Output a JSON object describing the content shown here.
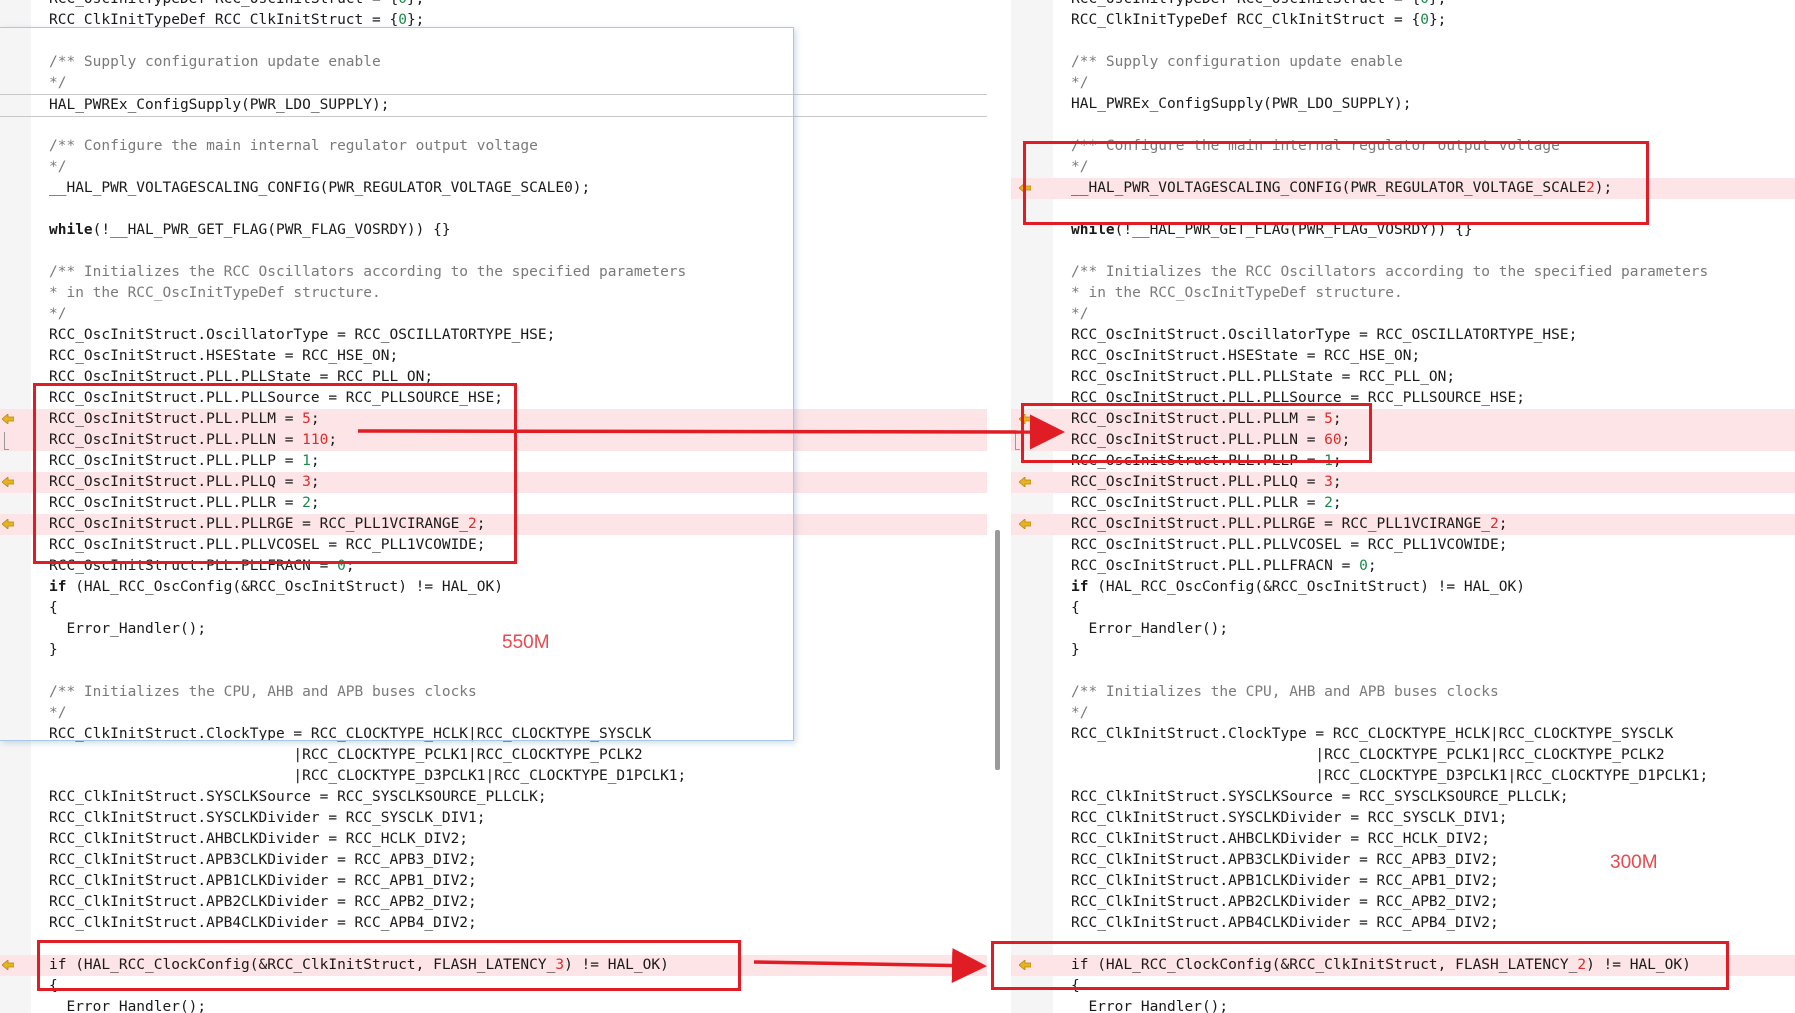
{
  "colors": {
    "diff_bg": "#fde4e6",
    "changed_text": "#e02b2b",
    "number_text": "#1a8a4a",
    "comment_text": "#7a7a7a",
    "annotation_red": "#e01c24"
  },
  "annotations": {
    "left_label": "550M",
    "right_label": "300M"
  },
  "left": {
    "lines": [
      {
        "parts": [
          {
            "t": "RCC_OscInitTypeDef RCC_OscInitStruct = {"
          },
          {
            "t": "0",
            "c": "num"
          },
          {
            "t": "};"
          }
        ]
      },
      {
        "parts": [
          {
            "t": "RCC_ClkInitTypeDef RCC_ClkInitStruct = {"
          },
          {
            "t": "0",
            "c": "num"
          },
          {
            "t": "};"
          }
        ]
      },
      {
        "parts": []
      },
      {
        "parts": [
          {
            "t": "/** Supply configuration update enable",
            "c": "cm"
          }
        ]
      },
      {
        "parts": [
          {
            "t": "*/",
            "c": "cm"
          }
        ]
      },
      {
        "parts": [
          {
            "t": "HAL_PWREx_ConfigSupply(PWR_LDO_SUPPLY);"
          }
        ],
        "boxed": true
      },
      {
        "parts": []
      },
      {
        "parts": [
          {
            "t": "/** Configure the main internal regulator output voltage",
            "c": "cm"
          }
        ]
      },
      {
        "parts": [
          {
            "t": "*/",
            "c": "cm"
          }
        ]
      },
      {
        "parts": [
          {
            "t": "__HAL_PWR_VOLTAGESCALING_CONFIG(PWR_REGULATOR_VOLTAGE_SCALE"
          },
          {
            "t": "0"
          },
          {
            "t": ");"
          }
        ]
      },
      {
        "parts": []
      },
      {
        "parts": [
          {
            "t": "while",
            "c": "kw"
          },
          {
            "t": "(!__HAL_PWR_GET_FLAG(PWR_FLAG_VOSRDY)) {}"
          }
        ]
      },
      {
        "parts": []
      },
      {
        "parts": [
          {
            "t": "/** Initializes the RCC Oscillators according to the specified parameters",
            "c": "cm"
          }
        ]
      },
      {
        "parts": [
          {
            "t": "* in the RCC_OscInitTypeDef structure.",
            "c": "cm"
          }
        ]
      },
      {
        "parts": [
          {
            "t": "*/",
            "c": "cm"
          }
        ]
      },
      {
        "parts": [
          {
            "t": "RCC_OscInitStruct.OscillatorType = RCC_OSCILLATORTYPE_HSE;"
          }
        ]
      },
      {
        "parts": [
          {
            "t": "RCC_OscInitStruct.HSEState = RCC_HSE_ON;"
          }
        ]
      },
      {
        "parts": [
          {
            "t": "RCC_OscInitStruct.PLL.PLLState = RCC_PLL_ON;"
          }
        ]
      },
      {
        "parts": [
          {
            "t": "RCC_OscInitStruct.PLL.PLLSource = RCC_PLLSOURCE_HSE;"
          }
        ]
      },
      {
        "parts": [
          {
            "t": "RCC_OscInitStruct.PLL.PLLM = "
          },
          {
            "t": "5",
            "c": "chg"
          },
          {
            "t": ";"
          }
        ],
        "diff": true,
        "marker": "arrow"
      },
      {
        "parts": [
          {
            "t": "RCC_OscInitStruct.PLL.PLLN = "
          },
          {
            "t": "110",
            "c": "chg"
          },
          {
            "t": ";"
          }
        ],
        "diff": true,
        "marker": "bracket"
      },
      {
        "parts": [
          {
            "t": "RCC_OscInitStruct.PLL.PLLP = "
          },
          {
            "t": "1",
            "c": "num"
          },
          {
            "t": ";"
          }
        ]
      },
      {
        "parts": [
          {
            "t": "RCC_OscInitStruct.PLL.PLLQ = "
          },
          {
            "t": "3",
            "c": "chg"
          },
          {
            "t": ";"
          }
        ],
        "diff": true,
        "marker": "arrow"
      },
      {
        "parts": [
          {
            "t": "RCC_OscInitStruct.PLL.PLLR = "
          },
          {
            "t": "2",
            "c": "num"
          },
          {
            "t": ";"
          }
        ]
      },
      {
        "parts": [
          {
            "t": "RCC_OscInitStruct.PLL.PLLRGE = RCC_PLL1VCIRANGE_"
          },
          {
            "t": "2",
            "c": "chg"
          },
          {
            "t": ";"
          }
        ],
        "diff": true,
        "marker": "arrow"
      },
      {
        "parts": [
          {
            "t": "RCC_OscInitStruct.PLL.PLLVCOSEL = RCC_PLL1VCOWIDE;"
          }
        ]
      },
      {
        "parts": [
          {
            "t": "RCC_OscInitStruct.PLL.PLLFRACN = "
          },
          {
            "t": "0",
            "c": "num"
          },
          {
            "t": ";"
          }
        ]
      },
      {
        "parts": [
          {
            "t": "if",
            "c": "kw"
          },
          {
            "t": " (HAL_RCC_OscConfig(&RCC_OscInitStruct) != HAL_OK)"
          }
        ]
      },
      {
        "parts": [
          {
            "t": "{"
          }
        ]
      },
      {
        "parts": [
          {
            "t": "  Error_Handler();"
          }
        ]
      },
      {
        "parts": [
          {
            "t": "}"
          }
        ]
      },
      {
        "parts": []
      },
      {
        "parts": [
          {
            "t": "/** Initializes the CPU, AHB and APB buses clocks",
            "c": "cm"
          }
        ]
      },
      {
        "parts": [
          {
            "t": "*/",
            "c": "cm"
          }
        ]
      },
      {
        "parts": [
          {
            "t": "RCC_ClkInitStruct.ClockType = RCC_CLOCKTYPE_HCLK|RCC_CLOCKTYPE_SYSCLK"
          }
        ]
      },
      {
        "parts": [
          {
            "t": "                            |RCC_CLOCKTYPE_PCLK1|RCC_CLOCKTYPE_PCLK2"
          }
        ]
      },
      {
        "parts": [
          {
            "t": "                            |RCC_CLOCKTYPE_D3PCLK1|RCC_CLOCKTYPE_D1PCLK1;"
          }
        ]
      },
      {
        "parts": [
          {
            "t": "RCC_ClkInitStruct.SYSCLKSource = RCC_SYSCLKSOURCE_PLLCLK;"
          }
        ]
      },
      {
        "parts": [
          {
            "t": "RCC_ClkInitStruct.SYSCLKDivider = RCC_SYSCLK_DIV1;"
          }
        ]
      },
      {
        "parts": [
          {
            "t": "RCC_ClkInitStruct.AHBCLKDivider = RCC_HCLK_DIV2;"
          }
        ]
      },
      {
        "parts": [
          {
            "t": "RCC_ClkInitStruct.APB3CLKDivider = RCC_APB3_DIV2;"
          }
        ]
      },
      {
        "parts": [
          {
            "t": "RCC_ClkInitStruct.APB1CLKDivider = RCC_APB1_DIV2;"
          }
        ]
      },
      {
        "parts": [
          {
            "t": "RCC_ClkInitStruct.APB2CLKDivider = RCC_APB2_DIV2;"
          }
        ]
      },
      {
        "parts": [
          {
            "t": "RCC_ClkInitStruct.APB4CLKDivider = RCC_APB4_DIV2;"
          }
        ]
      },
      {
        "parts": []
      },
      {
        "parts": [
          {
            "t": "if (HAL_RCC_ClockConfig(&RCC_ClkInitStruct, FLASH_LATENCY_"
          },
          {
            "t": "3",
            "c": "chg"
          },
          {
            "t": ") != HAL_OK)"
          }
        ],
        "diff": true,
        "marker": "arrow"
      },
      {
        "parts": [
          {
            "t": "{"
          }
        ]
      },
      {
        "parts": [
          {
            "t": "  Error_Handler();"
          }
        ]
      }
    ]
  },
  "right": {
    "lines": [
      {
        "parts": [
          {
            "t": "RCC_OscInitTypeDef RCC_OscInitStruct = {"
          },
          {
            "t": "0",
            "c": "num"
          },
          {
            "t": "};"
          }
        ]
      },
      {
        "parts": [
          {
            "t": "RCC_ClkInitTypeDef RCC_ClkInitStruct = {"
          },
          {
            "t": "0",
            "c": "num"
          },
          {
            "t": "};"
          }
        ]
      },
      {
        "parts": []
      },
      {
        "parts": [
          {
            "t": "/** Supply configuration update enable",
            "c": "cm"
          }
        ]
      },
      {
        "parts": [
          {
            "t": "*/",
            "c": "cm"
          }
        ]
      },
      {
        "parts": [
          {
            "t": "HAL_PWREx_ConfigSupply(PWR_LDO_SUPPLY);"
          }
        ]
      },
      {
        "parts": []
      },
      {
        "parts": [
          {
            "t": "/** Configure the main internal regulator output voltage",
            "c": "cm"
          }
        ]
      },
      {
        "parts": [
          {
            "t": "*/",
            "c": "cm"
          }
        ]
      },
      {
        "parts": [
          {
            "t": "__HAL_PWR_VOLTAGESCALING_CONFIG(PWR_REGULATOR_VOLTAGE_SCALE"
          },
          {
            "t": "2",
            "c": "chg"
          },
          {
            "t": ");"
          }
        ],
        "diff": true,
        "marker": "arrow"
      },
      {
        "parts": []
      },
      {
        "parts": [
          {
            "t": "while",
            "c": "kw"
          },
          {
            "t": "(!__HAL_PWR_GET_FLAG(PWR_FLAG_VOSRDY)) {}"
          }
        ]
      },
      {
        "parts": []
      },
      {
        "parts": [
          {
            "t": "/** Initializes the RCC Oscillators according to the specified parameters",
            "c": "cm"
          }
        ]
      },
      {
        "parts": [
          {
            "t": "* in the RCC_OscInitTypeDef structure.",
            "c": "cm"
          }
        ]
      },
      {
        "parts": [
          {
            "t": "*/",
            "c": "cm"
          }
        ]
      },
      {
        "parts": [
          {
            "t": "RCC_OscInitStruct.OscillatorType = RCC_OSCILLATORTYPE_HSE;"
          }
        ]
      },
      {
        "parts": [
          {
            "t": "RCC_OscInitStruct.HSEState = RCC_HSE_ON;"
          }
        ]
      },
      {
        "parts": [
          {
            "t": "RCC_OscInitStruct.PLL.PLLState = RCC_PLL_ON;"
          }
        ]
      },
      {
        "parts": [
          {
            "t": "RCC_OscInitStruct.PLL.PLLSource = RCC_PLLSOURCE_HSE;"
          }
        ]
      },
      {
        "parts": [
          {
            "t": "RCC_OscInitStruct.PLL.PLLM = "
          },
          {
            "t": "5",
            "c": "chg"
          },
          {
            "t": ";"
          }
        ],
        "diff": true,
        "marker": "arrow"
      },
      {
        "parts": [
          {
            "t": "RCC_OscInitStruct.PLL.PLLN = "
          },
          {
            "t": "60",
            "c": "chg"
          },
          {
            "t": ";"
          }
        ],
        "diff": true,
        "marker": "bracket"
      },
      {
        "parts": [
          {
            "t": "RCC_OscInitStruct.PLL.PLLP = "
          },
          {
            "t": "1",
            "c": "num"
          },
          {
            "t": ";"
          }
        ]
      },
      {
        "parts": [
          {
            "t": "RCC_OscInitStruct.PLL.PLLQ = "
          },
          {
            "t": "3",
            "c": "chg"
          },
          {
            "t": ";"
          }
        ],
        "diff": true,
        "marker": "arrow"
      },
      {
        "parts": [
          {
            "t": "RCC_OscInitStruct.PLL.PLLR = "
          },
          {
            "t": "2",
            "c": "num"
          },
          {
            "t": ";"
          }
        ]
      },
      {
        "parts": [
          {
            "t": "RCC_OscInitStruct.PLL.PLLRGE = RCC_PLL1VCIRANGE_"
          },
          {
            "t": "2",
            "c": "chg"
          },
          {
            "t": ";"
          }
        ],
        "diff": true,
        "marker": "arrow"
      },
      {
        "parts": [
          {
            "t": "RCC_OscInitStruct.PLL.PLLVCOSEL = RCC_PLL1VCOWIDE;"
          }
        ]
      },
      {
        "parts": [
          {
            "t": "RCC_OscInitStruct.PLL.PLLFRACN = "
          },
          {
            "t": "0",
            "c": "num"
          },
          {
            "t": ";"
          }
        ]
      },
      {
        "parts": [
          {
            "t": "if",
            "c": "kw"
          },
          {
            "t": " (HAL_RCC_OscConfig(&RCC_OscInitStruct) != HAL_OK)"
          }
        ]
      },
      {
        "parts": [
          {
            "t": "{"
          }
        ]
      },
      {
        "parts": [
          {
            "t": "  Error_Handler();"
          }
        ]
      },
      {
        "parts": [
          {
            "t": "}"
          }
        ]
      },
      {
        "parts": []
      },
      {
        "parts": [
          {
            "t": "/** Initializes the CPU, AHB and APB buses clocks",
            "c": "cm"
          }
        ]
      },
      {
        "parts": [
          {
            "t": "*/",
            "c": "cm"
          }
        ]
      },
      {
        "parts": [
          {
            "t": "RCC_ClkInitStruct.ClockType = RCC_CLOCKTYPE_HCLK|RCC_CLOCKTYPE_SYSCLK"
          }
        ]
      },
      {
        "parts": [
          {
            "t": "                            |RCC_CLOCKTYPE_PCLK1|RCC_CLOCKTYPE_PCLK2"
          }
        ]
      },
      {
        "parts": [
          {
            "t": "                            |RCC_CLOCKTYPE_D3PCLK1|RCC_CLOCKTYPE_D1PCLK1;"
          }
        ]
      },
      {
        "parts": [
          {
            "t": "RCC_ClkInitStruct.SYSCLKSource = RCC_SYSCLKSOURCE_PLLCLK;"
          }
        ]
      },
      {
        "parts": [
          {
            "t": "RCC_ClkInitStruct.SYSCLKDivider = RCC_SYSCLK_DIV1;"
          }
        ]
      },
      {
        "parts": [
          {
            "t": "RCC_ClkInitStruct.AHBCLKDivider = RCC_HCLK_DIV2;"
          }
        ]
      },
      {
        "parts": [
          {
            "t": "RCC_ClkInitStruct.APB3CLKDivider = RCC_APB3_DIV2;"
          }
        ]
      },
      {
        "parts": [
          {
            "t": "RCC_ClkInitStruct.APB1CLKDivider = RCC_APB1_DIV2;"
          }
        ]
      },
      {
        "parts": [
          {
            "t": "RCC_ClkInitStruct.APB2CLKDivider = RCC_APB2_DIV2;"
          }
        ]
      },
      {
        "parts": [
          {
            "t": "RCC_ClkInitStruct.APB4CLKDivider = RCC_APB4_DIV2;"
          }
        ]
      },
      {
        "parts": []
      },
      {
        "parts": [
          {
            "t": "if (HAL_RCC_ClockConfig(&RCC_ClkInitStruct, FLASH_LATENCY_"
          },
          {
            "t": "2",
            "c": "chg"
          },
          {
            "t": ") != HAL_OK)"
          }
        ],
        "diff": true,
        "marker": "arrow"
      },
      {
        "parts": [
          {
            "t": "{"
          }
        ]
      },
      {
        "parts": [
          {
            "t": "  Error_Handler();"
          }
        ]
      }
    ]
  }
}
